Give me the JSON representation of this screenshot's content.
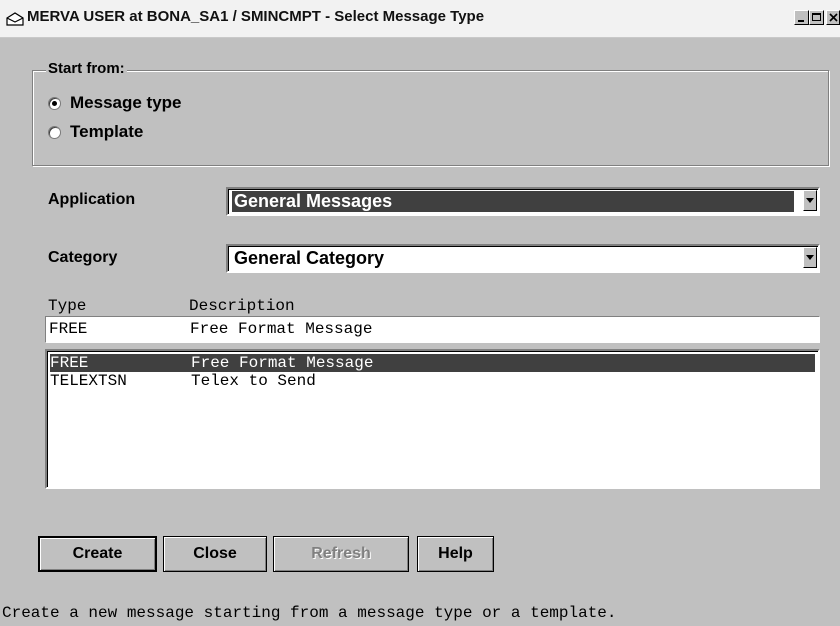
{
  "window": {
    "title": "MERVA USER at BONA_SA1 / SMINCMPT - Select Message Type"
  },
  "start_from": {
    "legend": "Start from:",
    "options": [
      {
        "label": "Message type",
        "selected": true
      },
      {
        "label": "Template",
        "selected": false
      }
    ]
  },
  "application": {
    "label": "Application",
    "value": "General Messages"
  },
  "category": {
    "label": "Category",
    "value": "General Category"
  },
  "type_list": {
    "headers": {
      "type": "Type",
      "description": "Description"
    },
    "entry": {
      "type": "FREE",
      "description": "Free Format Message"
    },
    "rows": [
      {
        "type": "FREE",
        "description": "Free Format Message",
        "selected": true
      },
      {
        "type": "TELEXTSN",
        "description": "Telex to Send",
        "selected": false
      }
    ]
  },
  "buttons": {
    "create": "Create",
    "close": "Close",
    "refresh": "Refresh",
    "help": "Help"
  },
  "status_bar": {
    "text": "Create a new message starting from a message type or a template."
  }
}
